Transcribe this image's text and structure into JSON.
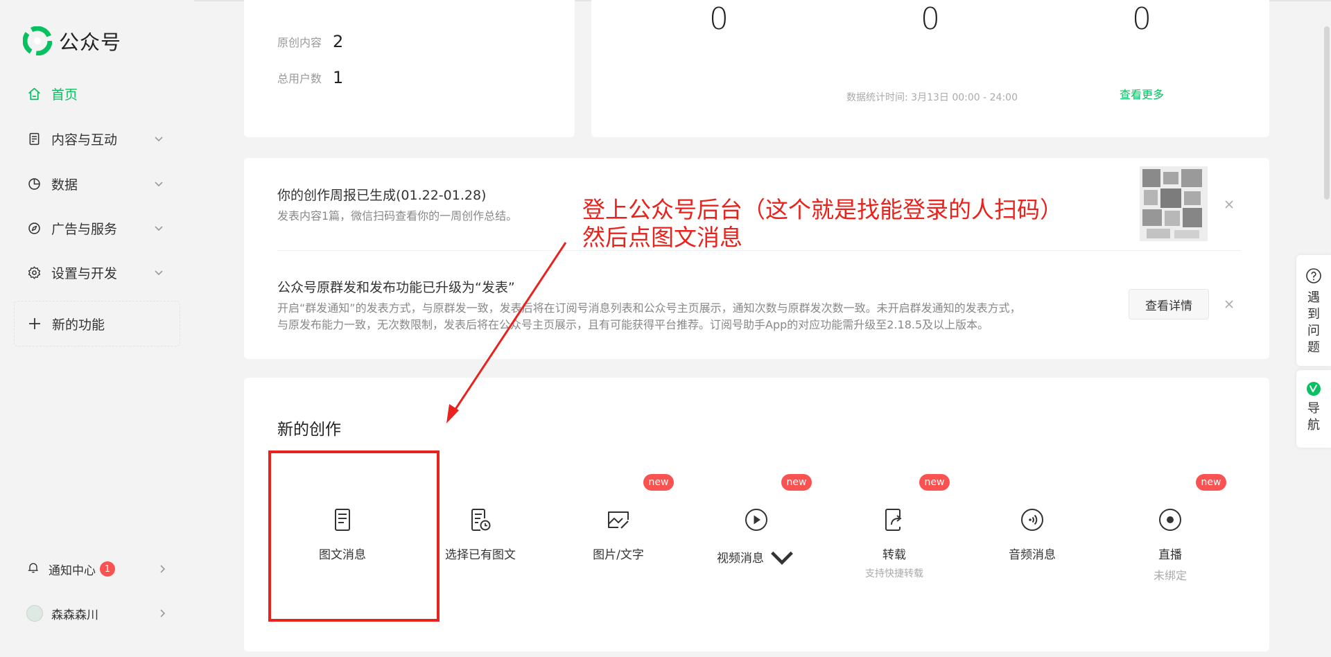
{
  "app": {
    "name": "公众号"
  },
  "sidebar": {
    "items": [
      {
        "label": "首页"
      },
      {
        "label": "内容与互动"
      },
      {
        "label": "数据"
      },
      {
        "label": "广告与服务"
      },
      {
        "label": "设置与开发"
      }
    ],
    "new_function": "新的功能",
    "notification": {
      "label": "通知中心",
      "count": "1"
    },
    "user": {
      "name": "森森森川"
    }
  },
  "stats": {
    "original_label": "原创内容",
    "original_value": "2",
    "users_label": "总用户数",
    "users_value": "1"
  },
  "overview": {
    "numbers": [
      "0",
      "0",
      "0"
    ],
    "time_note": "数据统计时间: 3月13日 00:00 - 24:00",
    "more_link": "查看更多"
  },
  "notices": [
    {
      "title": "你的创作周报已生成(01.22-01.28)",
      "desc": "发表内容1篇，微信扫码查看你的一周创作总结。"
    },
    {
      "title": "公众号原群发和发布功能已升级为“发表”",
      "desc_line1": "开启“群发通知”的发表方式，与原群发一致，发表后将在订阅号消息列表和公众号主页展示，通知次数与原群发次数一致。未开启群发通知的发表方式，",
      "desc_line2": "与原发布能力一致，无次数限制，发表后将在公众号主页展示，且有可能获得平台推荐。订阅号助手App的对应功能需升级至2.18.5及以上版本。",
      "button": "查看详情"
    }
  ],
  "create": {
    "title": "新的创作",
    "new_badge": "new",
    "items": [
      {
        "label": "图文消息",
        "icon": "document-icon"
      },
      {
        "label": "选择已有图文",
        "icon": "document-clock-icon"
      },
      {
        "label": "图片/文字",
        "icon": "image-icon"
      },
      {
        "label": "视频消息",
        "icon": "play-icon"
      },
      {
        "label": "转载",
        "sub": "支持快捷转载",
        "icon": "share-icon"
      },
      {
        "label": "音频消息",
        "icon": "audio-icon"
      },
      {
        "label": "直播",
        "sub": "未绑定",
        "icon": "live-icon"
      }
    ]
  },
  "annotation": {
    "line1": "登上公众号后台（这个就是找能登录的人扫码）",
    "line2": "然后点图文消息"
  },
  "float": {
    "help": "遇到问题",
    "guide": "导航"
  },
  "colors": {
    "accent": "#07c160",
    "red": "#e8221c",
    "badge": "#fa5151"
  }
}
